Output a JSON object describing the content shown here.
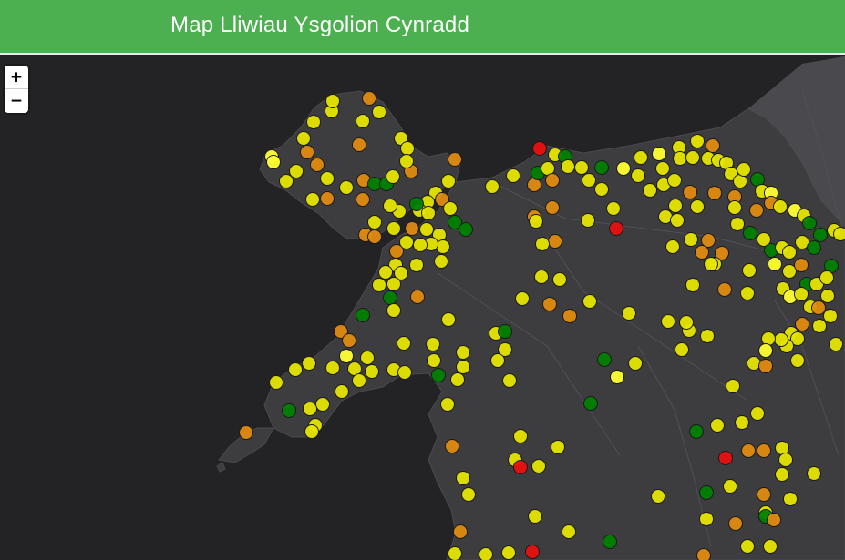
{
  "header": {
    "title": "Map Lliwiau Ysgolion Cynradd"
  },
  "zoom": {
    "in_label": "+",
    "out_label": "−"
  },
  "colors": {
    "green": "#008000",
    "yellow": "#e5e500",
    "yellow_light": "#ffff33",
    "orange": "#e08a10",
    "red": "#e81010",
    "land": "#3d3d40",
    "sea": "#232326"
  },
  "legend_categories": [
    "green",
    "yellow",
    "orange",
    "red"
  ]
}
